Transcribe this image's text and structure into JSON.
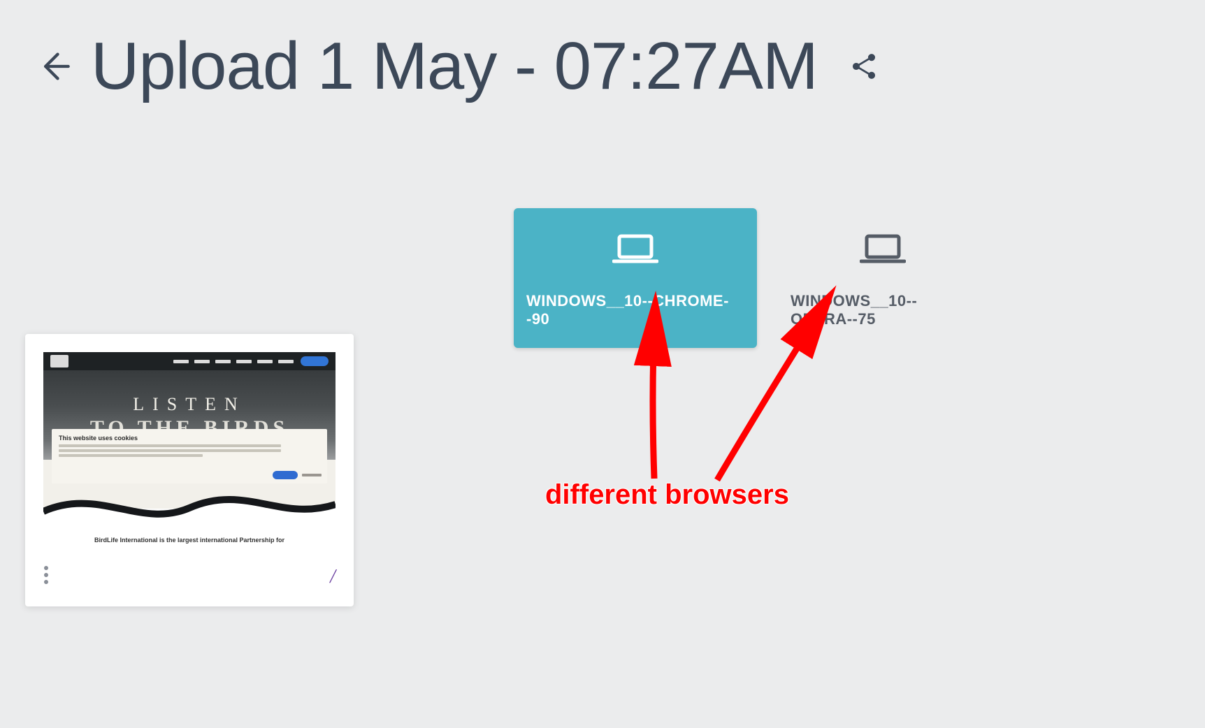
{
  "header": {
    "title": "Upload 1 May - 07:27AM"
  },
  "environments": [
    {
      "label": "WINDOWS__10--CHROME--90",
      "active": true
    },
    {
      "label": "WINDOWS__10--OPERA--75",
      "active": false
    }
  ],
  "annotation": {
    "label": "different browsers"
  },
  "thumbnail": {
    "site_hero_title": "LISTEN",
    "site_hero_sub": "TO THE BIRDS",
    "cookie_title": "This website uses cookies",
    "tagline": "BirdLife International is the largest international Partnership for",
    "footer_slash": "/"
  },
  "colors": {
    "accent": "#4bb3c6",
    "annotation_red": "#ff0000",
    "text": "#3c4858"
  }
}
